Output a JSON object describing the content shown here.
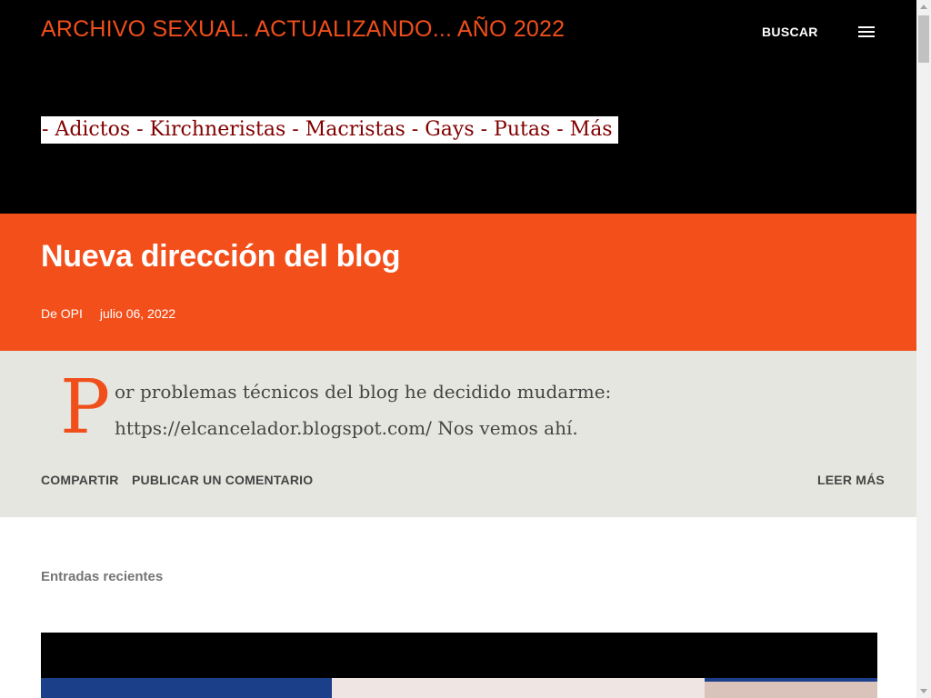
{
  "header": {
    "site_title": "ARCHIVO SEXUAL. ACTUALIZANDO... AÑO 2022",
    "search_label": "BUSCAR",
    "menu_icon": "hamburger-menu-icon",
    "tagline": "- Adictos - Kirchneristas - Macristas - Gays - Putas - Más"
  },
  "post": {
    "title": "Nueva dirección del blog",
    "author": "De OPI",
    "date": "julio 06, 2022",
    "drop_cap": "P",
    "body": "or problemas técnicos del blog he decidido mudarme: https://elcancelador.blogspot.com/ Nos vemos ahí.",
    "actions": {
      "share": "COMPARTIR",
      "comment": "PUBLICAR UN COMENTARIO",
      "read_more": "LEER MÁS"
    }
  },
  "recent": {
    "label": "Entradas recientes"
  },
  "colors": {
    "accent": "#f34f1a",
    "header_bg": "#000000",
    "body_bg": "#e6e6e0",
    "tagline_text": "#800000"
  }
}
